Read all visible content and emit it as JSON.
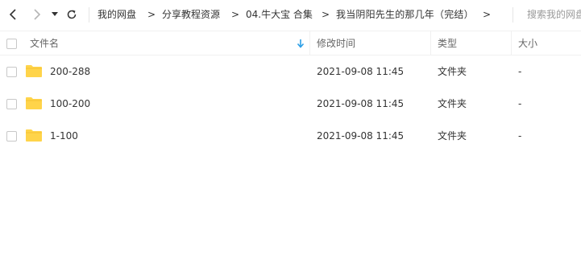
{
  "nav": {
    "back_icon": "chevron-left-icon",
    "forward_icon": "chevron-right-icon",
    "dropdown_icon": "caret-down-icon",
    "refresh_icon": "refresh-icon"
  },
  "breadcrumb": [
    {
      "label": "我的网盘"
    },
    {
      "label": "分享教程资源"
    },
    {
      "label": "04.牛大宝 合集"
    },
    {
      "label": "我当阴阳先生的那几年（完结）"
    }
  ],
  "breadcrumb_separator": ">",
  "search": {
    "placeholder": "搜索我的网盘文件"
  },
  "table": {
    "columns": {
      "name": "文件名",
      "modified": "修改时间",
      "type": "类型",
      "size": "大小"
    },
    "sort_icon": "arrow-down-icon",
    "rows": [
      {
        "name": "200-288",
        "modified": "2021-09-08 11:45",
        "type": "文件夹",
        "size": "-"
      },
      {
        "name": "100-200",
        "modified": "2021-09-08 11:45",
        "type": "文件夹",
        "size": "-"
      },
      {
        "name": "1-100",
        "modified": "2021-09-08 11:45",
        "type": "文件夹",
        "size": "-"
      }
    ]
  },
  "colors": {
    "folder": "#FFD44A",
    "sort_arrow": "#2b9ee6",
    "text": "#333333",
    "header_text": "#666666"
  }
}
